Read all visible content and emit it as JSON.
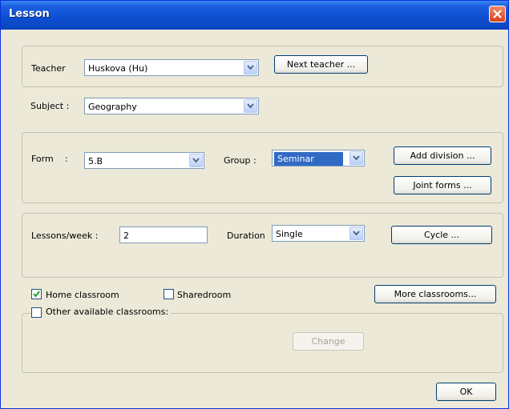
{
  "window": {
    "title": "Lesson"
  },
  "teacher": {
    "label": "Teacher",
    "value": "Huskova (Hu)",
    "next_button": "Next teacher ..."
  },
  "subject": {
    "label": "Subject :",
    "value": "Geography"
  },
  "form": {
    "label": "Form",
    "colon": ":",
    "value": "5.B",
    "group_label": "Group :",
    "group_value": "Seminar",
    "add_division_button": "Add division ...",
    "joint_forms_button": "Joint forms ..."
  },
  "lessons": {
    "label": "Lessons/week :",
    "value": "2",
    "duration_label": "Duration",
    "duration_value": "Single",
    "cycle_button": "Cycle ..."
  },
  "classrooms": {
    "home_label": "Home classroom",
    "home_checked": true,
    "shared_label": "Sharedroom",
    "shared_checked": false,
    "more_button": "More classrooms...",
    "other_label": "Other available classrooms:",
    "other_checked": false,
    "change_button": "Change"
  },
  "footer": {
    "ok_button": "OK"
  }
}
